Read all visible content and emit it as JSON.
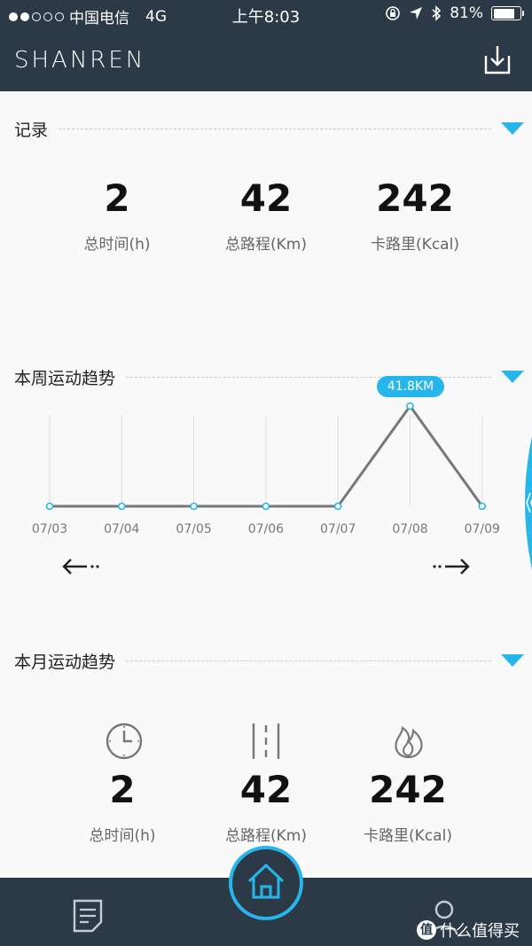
{
  "status_bar": {
    "carrier": "中国电信",
    "network": "4G",
    "time": "上午8:03",
    "battery_percent": "81%",
    "battery_level": 0.81,
    "signal_bars_filled": 2,
    "signal_bars_total": 5
  },
  "app": {
    "logo": "SHANREN"
  },
  "record": {
    "title": "记录",
    "stats": [
      {
        "value": "2",
        "label": "总时间(h)"
      },
      {
        "value": "42",
        "label": "总路程(Km)"
      },
      {
        "value": "242",
        "label": "卡路里(Kcal)"
      }
    ]
  },
  "weekly": {
    "title": "本周运动趋势",
    "highlight_label": "41.8KM"
  },
  "chart_data": {
    "type": "line",
    "categories": [
      "07/03",
      "07/04",
      "07/05",
      "07/06",
      "07/07",
      "07/08",
      "07/09"
    ],
    "values": [
      0,
      0,
      0,
      0,
      0,
      41.8,
      0
    ],
    "ylim": [
      0,
      41.8
    ],
    "grid": "vertical",
    "highlight_index": 5
  },
  "monthly": {
    "title": "本月运动趋势",
    "stats": [
      {
        "value": "2",
        "label": "总时间(h)",
        "icon": "clock-icon"
      },
      {
        "value": "42",
        "label": "总路程(Km)",
        "icon": "road-icon"
      },
      {
        "value": "242",
        "label": "卡路里(Kcal)",
        "icon": "flame-icon"
      }
    ]
  },
  "watermark": {
    "mark": "值",
    "text": "什么值得买"
  },
  "colors": {
    "dark_bar": "#2c3a47",
    "accent": "#27b6ec",
    "line": "#777777"
  }
}
